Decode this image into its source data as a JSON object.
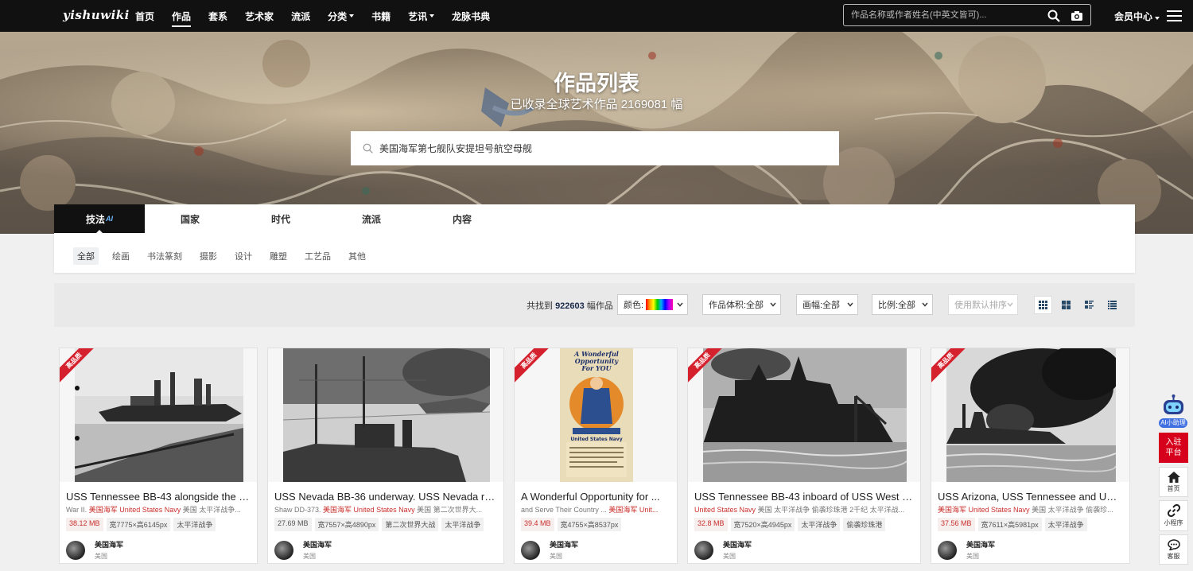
{
  "nav": {
    "logo": "yishuwiki",
    "items": [
      {
        "label": "首页",
        "active": false,
        "dropdown": false
      },
      {
        "label": "作品",
        "active": true,
        "dropdown": false
      },
      {
        "label": "套系",
        "active": false,
        "dropdown": false
      },
      {
        "label": "艺术家",
        "active": false,
        "dropdown": false
      },
      {
        "label": "流派",
        "active": false,
        "dropdown": false
      },
      {
        "label": "分类",
        "active": false,
        "dropdown": true
      },
      {
        "label": "书籍",
        "active": false,
        "dropdown": false
      },
      {
        "label": "艺讯",
        "active": false,
        "dropdown": true
      },
      {
        "label": "龙脉书典",
        "active": false,
        "dropdown": false
      }
    ],
    "search_placeholder": "作品名称或作者姓名(中英文皆可)...",
    "member_label": "会员中心"
  },
  "hero": {
    "title": "作品列表",
    "subtitle": "已收录全球艺术作品 2169081 幅",
    "search_value": "美国海军第七舰队安提坦号航空母舰"
  },
  "tabs": [
    {
      "label": "技法",
      "badge": "AI",
      "active": true
    },
    {
      "label": "国家",
      "active": false
    },
    {
      "label": "时代",
      "active": false
    },
    {
      "label": "流派",
      "active": false
    },
    {
      "label": "内容",
      "active": false
    }
  ],
  "subcategories": [
    {
      "label": "全部",
      "active": true
    },
    {
      "label": "绘画",
      "active": false
    },
    {
      "label": "书法篆刻",
      "active": false
    },
    {
      "label": "摄影",
      "active": false
    },
    {
      "label": "设计",
      "active": false
    },
    {
      "label": "雕塑",
      "active": false
    },
    {
      "label": "工艺品",
      "active": false
    },
    {
      "label": "其他",
      "active": false
    }
  ],
  "filters": {
    "count_prefix": "共找到",
    "count": "922603",
    "count_suffix": "幅作品",
    "color_label": "颜色:",
    "size_label": "作品体积:全部",
    "frame_label": "画幅:全部",
    "ratio_label": "比例:全部",
    "sort_label": "使用默认排序"
  },
  "cards": [
    {
      "title": "USS Tennessee BB-43 alongside the s...",
      "desc_prefix": "War II.",
      "desc_red": "美国海军 United States Navy",
      "desc_rest": "美国 太平洋战争...",
      "ribbon": "高品质",
      "tags": [
        {
          "text": "38.12 MB",
          "red": true
        },
        {
          "text": "宽7775×高6145px",
          "red": false
        },
        {
          "text": "太平洋战争",
          "red": false
        }
      ],
      "author": "美国海军",
      "country": "美国"
    },
    {
      "title": "USS Nevada BB-36 underway. USS Nevada rec...",
      "desc_prefix": "Shaw DD-373.",
      "desc_red": "美国海军 United States Navy",
      "desc_rest": "美国 第二次世界大...",
      "ribbon": "",
      "tags": [
        {
          "text": "27.69 MB",
          "red": false
        },
        {
          "text": "宽7557×高4890px",
          "red": false
        },
        {
          "text": "第二次世界大战",
          "red": false
        },
        {
          "text": "太平洋战争",
          "red": false
        }
      ],
      "author": "美国海军",
      "country": "美国"
    },
    {
      "title": "A Wonderful Opportunity for ...",
      "desc_prefix": "and Serve Their Country ...",
      "desc_red": "美国海军 Unit...",
      "desc_rest": "",
      "ribbon": "高品质",
      "tags": [
        {
          "text": "39.4 MB",
          "red": true
        },
        {
          "text": "宽4755×高8537px",
          "red": false
        }
      ],
      "author": "美国海军",
      "country": "美国",
      "poster_text": [
        "A Wonderful",
        "Opportunity",
        "For YOU",
        "United States Navy"
      ]
    },
    {
      "title": "USS Tennessee BB-43 inboard of USS West Vi...",
      "desc_prefix": "",
      "desc_red": "United States Navy",
      "desc_rest": "美国 太平洋战争 偷袭珍珠港 2千纪 太平洋战...",
      "ribbon": "高品质",
      "tags": [
        {
          "text": "32.8 MB",
          "red": true
        },
        {
          "text": "宽7520×高4945px",
          "red": false
        },
        {
          "text": "太平洋战争",
          "red": false
        },
        {
          "text": "偷袭珍珠港",
          "red": false
        }
      ],
      "author": "美国海军",
      "country": "美国"
    },
    {
      "title": "USS Arizona, USS Tennessee and USS ...",
      "desc_prefix": "",
      "desc_red": "美国海军 United States Navy",
      "desc_rest": "美国 太平洋战争 偷袭珍...",
      "ribbon": "高品质",
      "tags": [
        {
          "text": "37.56 MB",
          "red": true
        },
        {
          "text": "宽7611×高5981px",
          "red": false
        },
        {
          "text": "太平洋战争",
          "red": false
        }
      ],
      "author": "美国海军",
      "country": "美国"
    }
  ],
  "rail": {
    "ai_label": "AI小助理",
    "join_label_1": "入驻",
    "join_label_2": "平台",
    "home_label": "首页",
    "mini_label": "小程序",
    "service_label": "客服"
  }
}
